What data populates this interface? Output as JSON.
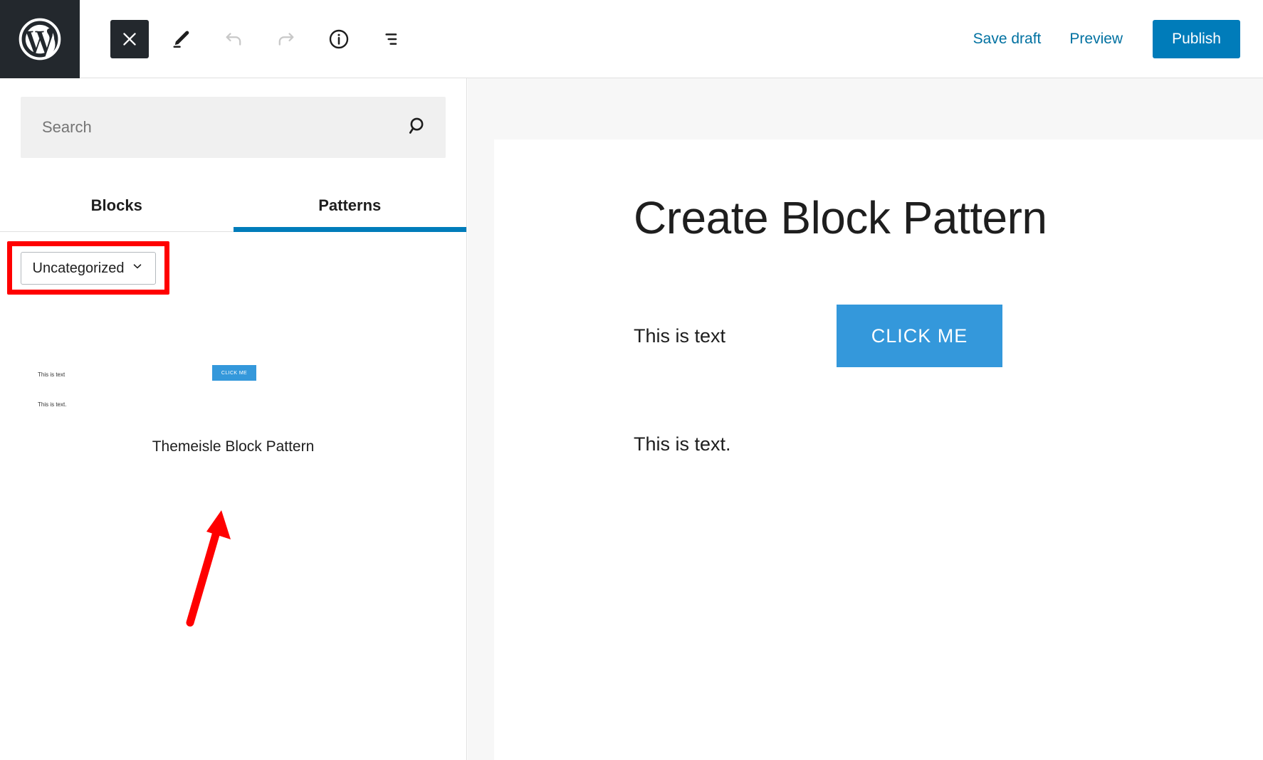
{
  "topbar": {
    "logo_icon": "wordpress-logo",
    "close_icon": "close-x-icon",
    "edit_icon": "pencil-edit-icon",
    "undo_icon": "undo-arrow-icon",
    "redo_icon": "redo-arrow-icon",
    "info_icon": "info-circle-icon",
    "listview_icon": "list-view-icon",
    "save_draft_label": "Save draft",
    "preview_label": "Preview",
    "publish_label": "Publish",
    "publish_bg": "#007cba",
    "link_color": "#0071a1"
  },
  "inserter": {
    "search": {
      "value": "",
      "placeholder": "Search",
      "icon": "search-icon"
    },
    "tabs": [
      {
        "label": "Blocks",
        "active": false
      },
      {
        "label": "Patterns",
        "active": true
      }
    ],
    "active_tab_underline_color": "#007cba",
    "category": {
      "selected": "Uncategorized",
      "chevron_icon": "chevron-down-icon",
      "highlight_color": "#ff0000"
    },
    "patterns": [
      {
        "label": "Themeisle Block Pattern",
        "preview": {
          "text_left": "This is text",
          "button_label": "CLICK ME",
          "text_bottom": "This is text.",
          "button_color": "#3498db"
        }
      }
    ],
    "annotation_arrow_color": "#ff0000"
  },
  "canvas": {
    "post_title": "Create Block Pattern",
    "blocks": {
      "row_text": "This is text",
      "cta_label": "CLICK ME",
      "cta_color": "#3498db",
      "paragraph": "This is text."
    }
  }
}
